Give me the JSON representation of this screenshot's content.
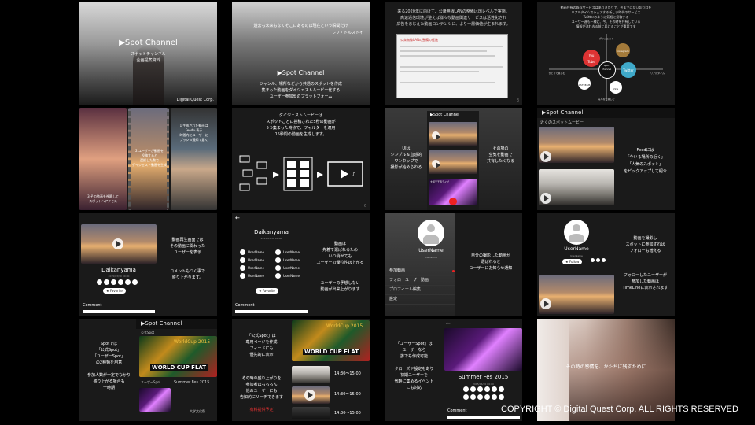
{
  "copyright": "COPYRIGHT © Digital Quest Corp. ALL RIGHTS RESERVED",
  "brand": "▶Spot Channel",
  "slides": {
    "s1": {
      "brand": "▶Spot Channel",
      "sub": "スポットチャンネル\n企画提案資料",
      "corp": "Digital Quest Corp."
    },
    "s2": {
      "quote": "過去も未来もなくそこにあるのは現在という瞬間だけ",
      "author": "レフ・トルストイ",
      "brand": "▶Spot Channel",
      "desc": "ジャンル、場所などから共通のスポットを作成\n集まった動画をダイジェストムービー化する\nユーザー参加型のプラットフォーム"
    },
    "s3": {
      "text": "来る2020年に向けて、公衆無線LANの整備は国レベルで実施。\n高速通信環境が整えば様々な動画関連サービスは活性化され\n広告をまじえた動画コンテンツに、より一層価値が生まれます。",
      "doc_title": "公衆無線LANの整備の促進",
      "pn": "3"
    },
    "s4": {
      "text": "動画共有の既存サービスはありきたりで、今までにない切り口を\nリアルタイムでシェアする新しい時代のサービス\nTwitterのように気軽に投稿する\nユーザー達も一様に、今、その時を共有している\n情報が流れ去る前に届けることが重要です",
      "center": "Spot\nChannel",
      "youtube": "You\nTube",
      "instagram": "Instagram",
      "twitter": "Twitter",
      "ustream": "USTREAM",
      "vine": "Vine",
      "l_top": "ダイジェスト",
      "l_right": "リアルタイム",
      "l_bottom": "みんなで楽しむ",
      "l_left": "ひとりで楽しむ"
    },
    "s5": {
      "t1": "1.生成された動画は\nFeedへ表示\n時間内にユーザーに\nプッシュ通知で届く",
      "t2": "2.ユーザーが動画を\n投稿すると\n選択した数で\nダイジェスト動画を生成",
      "t3": "3.その動画を視聴して\nスポットへアクセス"
    },
    "s6": {
      "title": "ダイジェストムービーは\nスポットごとに投稿された5秒の動画が\n5つ集まった時点で、フィルターを適用\n15秒間の動画を生成します。",
      "pn": "6"
    },
    "s7": {
      "brand": "▶Spot Channel",
      "left": "UIは\nシンプル＆直感的\nワンタップで\n撮影が始められる",
      "right": "その場の\n空気を動画で\n共有したくなる",
      "place": "大阪天王寺ライブ"
    },
    "s8": {
      "brand": "▶Spot Channel",
      "sub": "近くのスポットムービー",
      "text": "Feedには\n「今いる場所の近く」\n「人気のスポット」\nをピックアップして紹介"
    },
    "s9": {
      "spot": "Daikanyama",
      "date": "2015/03/30 00:00",
      "text1": "動画再生画面では\nその動画に関わった\nユーザーを表示",
      "text2": "コメントもつく事で\n盛り上がります。",
      "fav": "★ Favorite",
      "comment": "Comment"
    },
    "s10": {
      "spot": "Daikanyama",
      "date": "2015/03/30 00:00",
      "users": [
        "UserName",
        "UserName",
        "UserName",
        "UserName",
        "UserName",
        "UserName",
        "UserName",
        "UserName"
      ],
      "text1": "動画は\n先着で選ばれるため\nいつ消せても\nユーザーの優位性は上がる",
      "text2": "ユーザーの予想しない\n動画が出来上がります",
      "fav": "★ Favorite",
      "comment": "Comment"
    },
    "s11": {
      "user": "UserName",
      "handle": "UserName",
      "menu": [
        "参加動画",
        "フォローユーザー動画",
        "プロフィール編集",
        "設定"
      ],
      "text": "自分の撮影した動画が\n選ばれると\nユーザーにお知らせ通知"
    },
    "s12": {
      "user": "UserName",
      "handle": "UserName",
      "follow": "★ Follow",
      "text1": "動画を撮影し\nスポットに参加すれば\nフォローも増える",
      "text2": "フォローしたユーザーが\n参加した動画は\nTimeLineに表示されます"
    },
    "s13": {
      "brand": "▶Spot Channel",
      "sub": "公式Spot",
      "left": "Spotでは\n「公式Spot」\n「ユーザーSpot」\nの2種類を用意\n\n参加人数が一定でなかり\n盛り上がる場合も\n一時期",
      "cup_title": "WorldCup 2015",
      "cup_banner": "WORLD CUP FLAT",
      "u_title": "ユーザーSpot",
      "fest": "Summer Fes 2015",
      "uni": "大学文化祭"
    },
    "s14": {
      "left1": "「公式Spot」は\n専用ページを作成\nフィードにも\n優先的に表示",
      "left2": "その時の盛り上がりを\n参加者はもちろん\n他のユーザーにも\n告知的にリーチできます",
      "red": "（有料提供予定）",
      "cup_title": "WorldCup 2015",
      "cup_banner": "WORLD CUP FLAT",
      "times": [
        "14:30～15:00",
        "14:30～15:00",
        "14:30～15:00"
      ]
    },
    "s15": {
      "left": "「ユーザーSpot」は\nユーザーなら\n誰でも作成可能\n\nクローズド設定もあり\n初期ユーザーを\n気軽に集めるイベント\nにも対応",
      "fest": "Summer Fes 2015",
      "date": "2015/04/20 00:00",
      "comment": "Comment"
    },
    "s16": {
      "text": "その時の感情を、かたちに残すために"
    }
  }
}
